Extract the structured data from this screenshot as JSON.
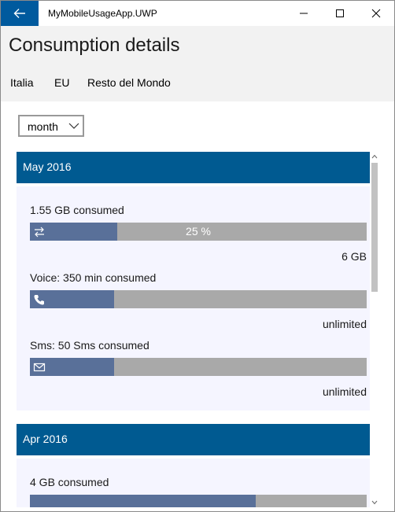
{
  "window": {
    "title": "MyMobileUsageApp.UWP"
  },
  "header": {
    "title": "Consumption details",
    "tabs": [
      {
        "label": "Italia"
      },
      {
        "label": "EU"
      },
      {
        "label": "Resto del Mondo"
      }
    ]
  },
  "filter": {
    "selected": "month"
  },
  "groups": [
    {
      "title": "May 2016",
      "items": [
        {
          "label": "1.55 GB consumed",
          "icon": "data-transfer-icon",
          "fill_fraction": 0.26,
          "percent_text": "25 %",
          "limit": "6 GB"
        },
        {
          "label": "Voice: 350 min consumed",
          "icon": "phone-icon",
          "fill_fraction": 0.25,
          "limit": "unlimited"
        },
        {
          "label": "Sms: 50 Sms consumed",
          "icon": "mail-icon",
          "fill_fraction": 0.25,
          "limit": "unlimited"
        }
      ]
    },
    {
      "title": "Apr 2016",
      "items": [
        {
          "label": "4 GB consumed",
          "fill_fraction": 0.67
        }
      ]
    }
  ],
  "colors": {
    "accent": "#005a9e",
    "group_header": "#005a91",
    "bar_fill": "#597099",
    "bar_track": "#a9a9a9"
  }
}
